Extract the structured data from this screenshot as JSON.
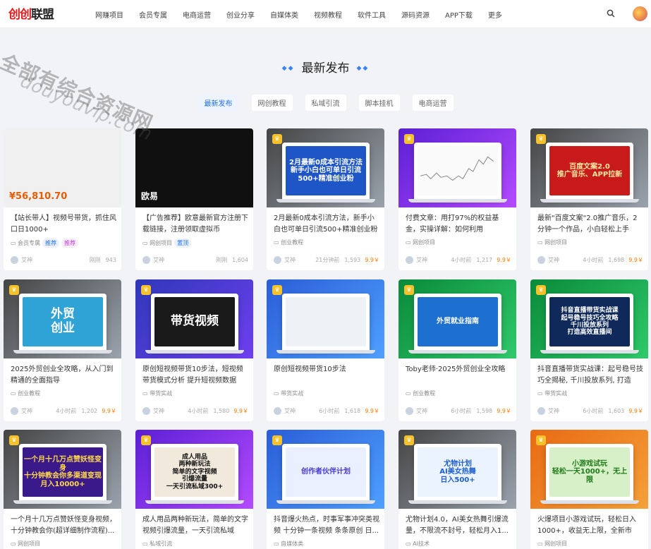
{
  "header": {
    "logo_red": "创创",
    "logo_black": "联盟",
    "nav": [
      "网赚项目",
      "会员专属",
      "电商运营",
      "创业分享",
      "自媒体类",
      "视频教程",
      "软件工具",
      "源码资源",
      "APP下载",
      "更多"
    ],
    "search_icon": "search-icon",
    "avatar": "user-avatar"
  },
  "watermark": {
    "line1": "全部有综合资源网",
    "line2": "douyouvip.com"
  },
  "section": {
    "title": "最新发布"
  },
  "tabs": [
    "最新发布",
    "网创教程",
    "私域引流",
    "脚本挂机",
    "电商运营"
  ],
  "cards": [
    {
      "thumb": "¥56,810.70",
      "title": "【站长带人】视频号带货，抓住风口日1000+",
      "cat": "会员专属",
      "tags": [
        "推荐",
        "推荐"
      ],
      "author": "艾神",
      "time": "刚刚",
      "views": "943",
      "price": ""
    },
    {
      "thumb": "欧易",
      "title": "【广告推荐】欧意最新官方注册下载链接，注册领取虚拟币",
      "cat": "网创项目",
      "tags": [
        "置顶"
      ],
      "author": "艾神",
      "time": "刚刚",
      "views": "1,604",
      "price": ""
    },
    {
      "thumb": "2月最新0成本引流方法\n新手小白也可单日引流\n500+精准创业粉",
      "title": "2月最新0成本引流方法，新手小白也可单日引流500+精准创业粉",
      "cat": "创业教程",
      "tags": [],
      "author": "艾神",
      "time": "21分钟前",
      "views": "1,593",
      "price": "9.9￥"
    },
    {
      "thumb": "",
      "title": "付费文章：用打97%的权益基金，实操详解：如何利用deepseek来...",
      "cat": "网创项目",
      "tags": [],
      "author": "艾神",
      "time": "4小时前",
      "views": "1,217",
      "price": "9.9￥"
    },
    {
      "thumb": "百度文案2.0\n推广音乐、APP拉新",
      "title": "最新\"百度文案\"2.0推广音乐，2分钟一个作品，小白轻松上手",
      "cat": "网创项目",
      "tags": [],
      "author": "艾神",
      "time": "4小时前",
      "views": "1,698",
      "price": "9.9￥"
    },
    {
      "thumb": "外贸\n创业",
      "title": "2025外贸创业全攻略，从入门到精通的全面指导",
      "cat": "创业教程",
      "tags": [],
      "author": "艾神",
      "time": "4小时前",
      "views": "1,202",
      "price": "9.9￥"
    },
    {
      "thumb": "带货视频",
      "title": "原创短视频带货10步法，短视频带货模式分析 提升短视频数据的...",
      "cat": "带货实战",
      "tags": [],
      "author": "艾神",
      "time": "4小时前",
      "views": "1,580",
      "price": "9.9￥"
    },
    {
      "thumb": "",
      "title": "原创短视频带货10步法",
      "cat": "带货实战",
      "tags": [],
      "author": "艾神",
      "time": "6小时前",
      "views": "1,618",
      "price": "9.9￥"
    },
    {
      "thumb": "外贸就业指南",
      "title": "Toby老师·2025外贸创业全攻略",
      "cat": "创业教程",
      "tags": [],
      "author": "艾神",
      "time": "6小时前",
      "views": "1,598",
      "price": "9.9￥"
    },
    {
      "thumb": "抖音直播带货实战课\n起号稳号技巧全攻略\n千川投放系列\n打造高效直播间",
      "title": "抖音直播带货实战课：起号稳号技巧全揭秘, 千川投放系列, 打造高...",
      "cat": "带货实战",
      "tags": [],
      "author": "艾神",
      "time": "6小时前",
      "views": "1,603",
      "price": "9.9￥"
    },
    {
      "thumb": "一个月十几万点赞妖怪变身\n十分钟教会你多渠道变现\n月入10000+",
      "title": "一个月十几万点赞妖怪变身视频，十分钟教会你(超详细制作流程)...",
      "cat": "网创项目",
      "tags": [],
      "author": "",
      "time": "",
      "views": "",
      "price": ""
    },
    {
      "thumb": "成人用品\n两种新玩法\n简单的文字视频\n引爆流量\n一天引流私域300+",
      "title": "成人用品两种新玩法，简单的文字视频引爆流量，一天引流私域30...",
      "cat": "私域引流",
      "tags": [],
      "author": "",
      "time": "",
      "views": "",
      "price": ""
    },
    {
      "thumb": "创作者伙伴计划",
      "title": "抖音爆火热点，时事军事冲突类视频 十分钟一条视频 条条原创 日...",
      "cat": "自媒体类",
      "tags": [],
      "author": "",
      "time": "",
      "views": "",
      "price": ""
    },
    {
      "thumb": "尤物计划\nAI美女热舞\n日入500+",
      "title": "尤物计划4.0，AI美女热舞引爆流量，不限流不封号，轻松月入1...",
      "cat": "AI技术",
      "tags": [],
      "author": "",
      "time": "",
      "views": "",
      "price": ""
    },
    {
      "thumb": "小游戏试玩\n轻松一天1000+，无上限",
      "title": "火爆项目小游戏试玩，轻松日入1000+，收益无上限，全新市场！",
      "cat": "网创项目",
      "tags": [],
      "author": "",
      "time": "",
      "views": "",
      "price": ""
    }
  ]
}
